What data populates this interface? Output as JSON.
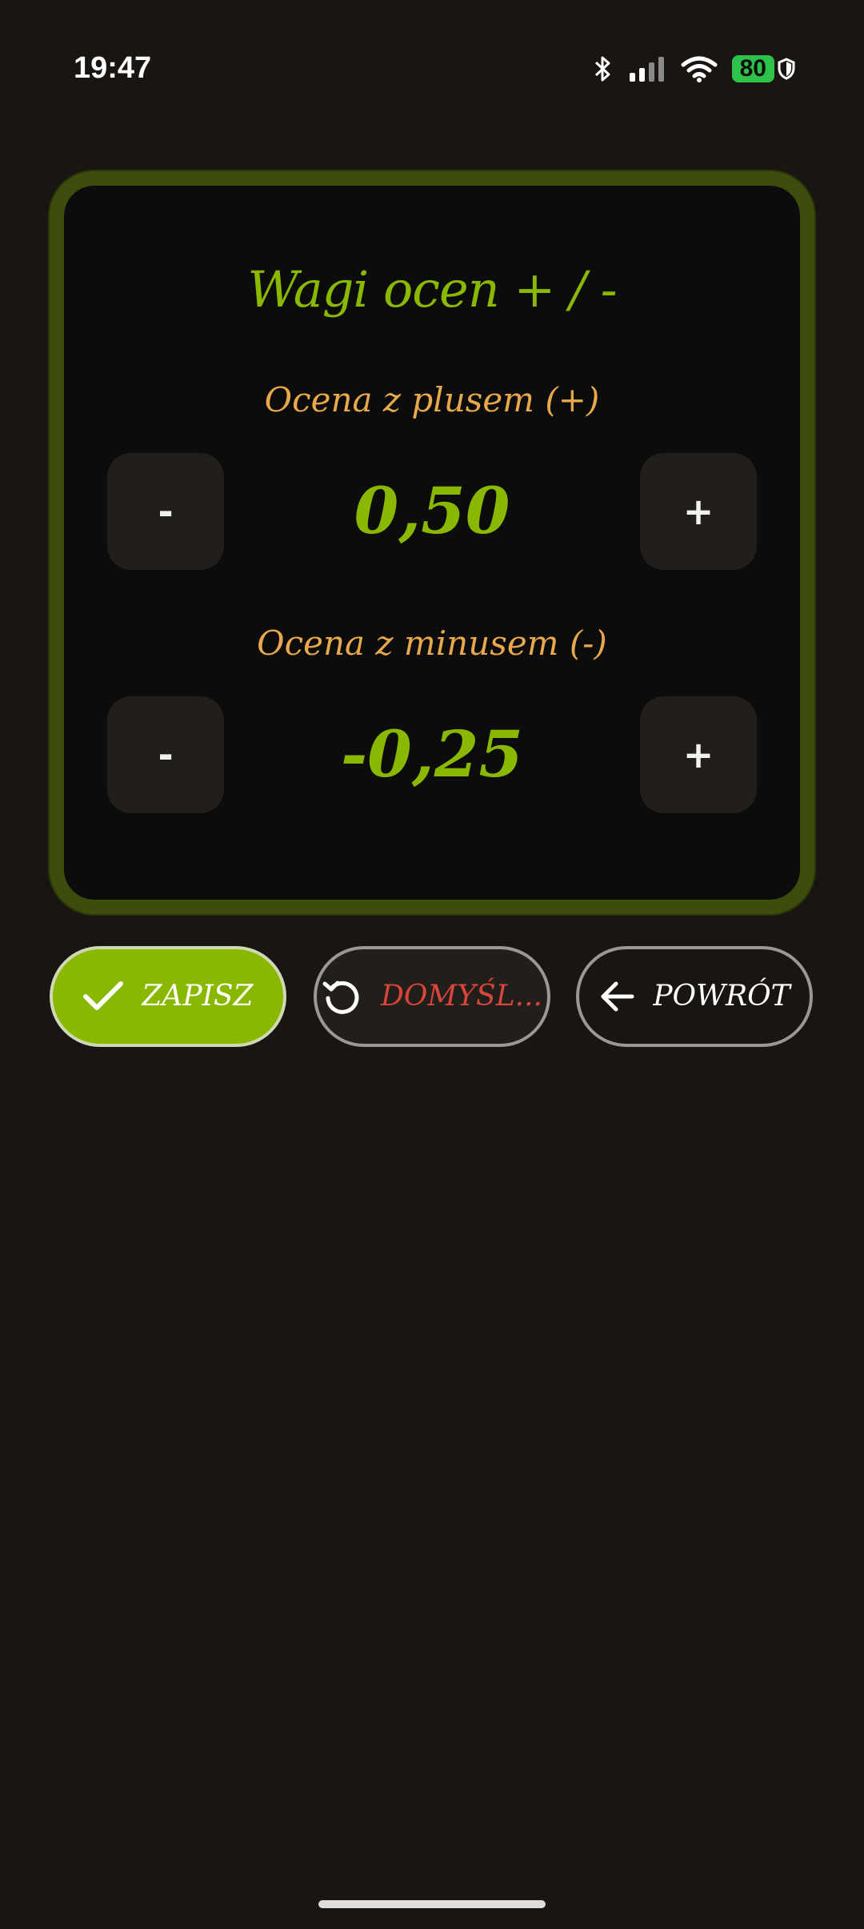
{
  "status_bar": {
    "time": "19:47",
    "battery": "80",
    "icons": [
      "bluetooth-icon",
      "signal-icon",
      "wifi-icon",
      "battery-icon",
      "shield-icon"
    ]
  },
  "card": {
    "title": "Wagi ocen + / -",
    "plus_section": {
      "label": "Ocena z plusem (+)",
      "value": "0,50",
      "decrement_label": "-",
      "increment_label": "+"
    },
    "minus_section": {
      "label": "Ocena z minusem (-)",
      "value": "-0,25",
      "decrement_label": "-",
      "increment_label": "+"
    }
  },
  "actions": {
    "save_label": "ZAPISZ",
    "default_label": "DOMYŚL...",
    "back_label": "POWRÓT"
  },
  "colors": {
    "accent": "#8ab800",
    "label": "#e8a84c",
    "danger": "#d9443c",
    "background": "#181512",
    "card_border": "#3c4d0c"
  }
}
